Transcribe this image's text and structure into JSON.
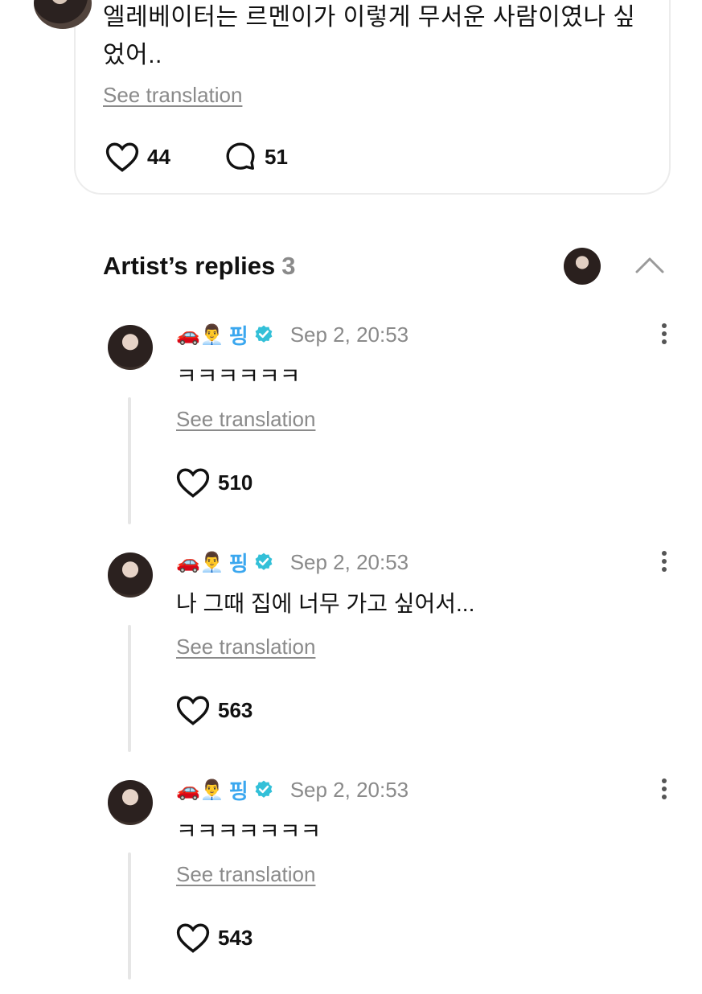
{
  "post": {
    "text": "엘레베이터는 르멘이가 이렇게 무서운 사람이였나 싶었어..",
    "see_translation": "See translation",
    "likes": "44",
    "comments": "51"
  },
  "artist_replies": {
    "title": "Artist’s replies",
    "count": "3"
  },
  "replies": [
    {
      "emojis": "🚗👨‍💼",
      "name": "핑",
      "time": "Sep 2, 20:53",
      "text": "ㅋㅋㅋㅋㅋㅋ",
      "see_translation": "See translation",
      "likes": "510"
    },
    {
      "emojis": "🚗👨‍💼",
      "name": "핑",
      "time": "Sep 2, 20:53",
      "text": "나 그때 집에 너무 가고 싶어서...",
      "see_translation": "See translation",
      "likes": "563"
    },
    {
      "emojis": "🚗👨‍💼",
      "name": "핑",
      "time": "Sep 2, 20:53",
      "text": "ㅋㅋㅋㅋㅋㅋㅋ",
      "see_translation": "See translation",
      "likes": "543"
    }
  ],
  "colors": {
    "accent": "#3aa7ef",
    "muted": "#8a8a8a",
    "text": "#111111",
    "verified": "#33c0d8"
  }
}
